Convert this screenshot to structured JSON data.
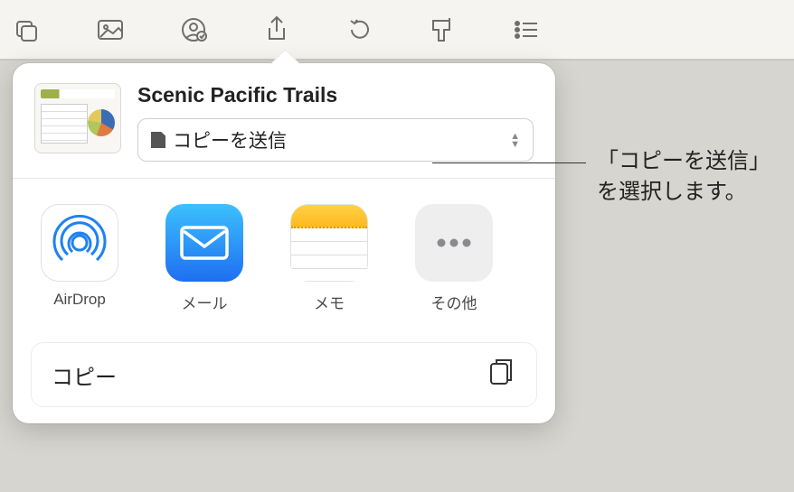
{
  "toolbar": {
    "items": [
      "insert-icon",
      "photo-icon",
      "people-icon",
      "share-icon",
      "undo-icon",
      "format-icon",
      "more-icon"
    ]
  },
  "document": {
    "title": "Scenic Pacific Trails"
  },
  "selector": {
    "label": "コピーを送信"
  },
  "share_apps": {
    "airdrop": "AirDrop",
    "mail": "メール",
    "notes": "メモ",
    "more": "その他"
  },
  "actions": {
    "copy": "コピー"
  },
  "callout": {
    "line1": "「コピーを送信」",
    "line2": "を選択します。"
  }
}
